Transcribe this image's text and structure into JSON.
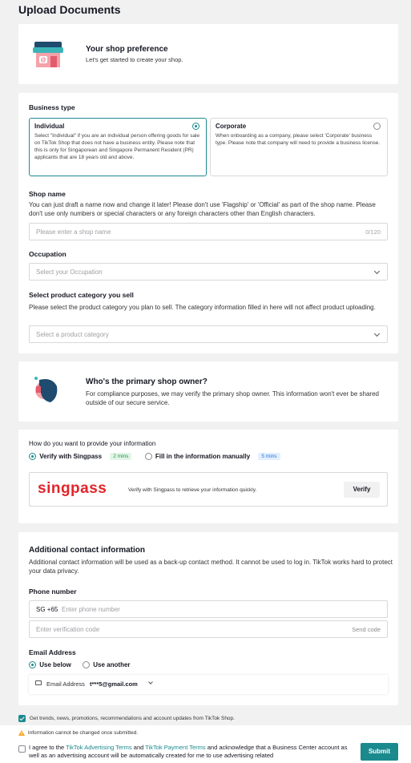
{
  "page": {
    "title": "Upload Documents"
  },
  "pref": {
    "title": "Your shop preference",
    "subtitle": "Let's get started to create your shop."
  },
  "business": {
    "label": "Business type",
    "individual": {
      "title": "Individual",
      "desc": "Select \"Individual\" if you are an individual person offering goods for sale on TikTok Shop that does not have a business entity. Please note that this is only for Singaporean and Singapore Permanent Resident (PR) applicants that are 18 years old and above."
    },
    "corporate": {
      "title": "Corporate",
      "desc": "When onboarding as a company, please select 'Corporate' business type. Please note that company will need to provide a business license."
    }
  },
  "shop_name": {
    "label": "Shop name",
    "desc": "You can just draft a name now and change it later! Please don't use 'Flagship' or 'Official' as part of the shop name. Please don't use only numbers or special characters or any foreign characters other than English characters.",
    "placeholder": "Please enter a shop name",
    "counter": "0/120"
  },
  "occupation": {
    "label": "Occupation",
    "placeholder": "Select your Occupation"
  },
  "category": {
    "label": "Select product category you sell",
    "desc": "Please select the product category you plan to sell. The category information filled in here will not affect product uploading.",
    "placeholder": "Select a product category"
  },
  "owner": {
    "title": "Who's the primary shop owner?",
    "desc": "For compliance purposes, we may verify the primary shop owner. This information won't ever be shared outside of our secure service."
  },
  "provide": {
    "label": "How do you want to provide your information",
    "opt1": "Verify with Singpass",
    "opt1_tag": "2 mins",
    "opt2": "Fill in the information manually",
    "opt2_tag": "5 mins",
    "singpass_logo": "singpass",
    "singpass_text": "Verify with Singpass to retrieve your information quickly.",
    "verify_button": "Verify"
  },
  "contact": {
    "title": "Additional contact information",
    "desc": "Additional contact information will be used as a back-up contact method. It cannot be used to log in. TikTok works hard to protect your data privacy.",
    "phone_label": "Phone number",
    "country_code": "SG +65",
    "phone_placeholder": "Enter phone number",
    "code_placeholder": "Enter verification code",
    "send_code": "Send code",
    "email_label": "Email Address",
    "use_below": "Use below",
    "use_another": "Use another",
    "email_prefix": "Email Address",
    "email_value": "t***5@gmail.com"
  },
  "footer": {
    "trends": "Get trends, news, promotions, recommendations and account updates from TikTok Shop.",
    "warning": "Information cannot be changed once submitted.",
    "agree_pre": "I agree to the ",
    "ads_terms": "TikTok Advertising Terms",
    "and": " and ",
    "pay_terms": "TikTok Payment Terms",
    "agree_post": " and acknowledge that a Business Center account as well as an advertising account will be automatically created for me to use advertising related",
    "submit": "Submit"
  },
  "colors": {
    "accent": "#1b8a8e",
    "singpass_red": "#e1242b",
    "submit": "#1b8a8e"
  }
}
